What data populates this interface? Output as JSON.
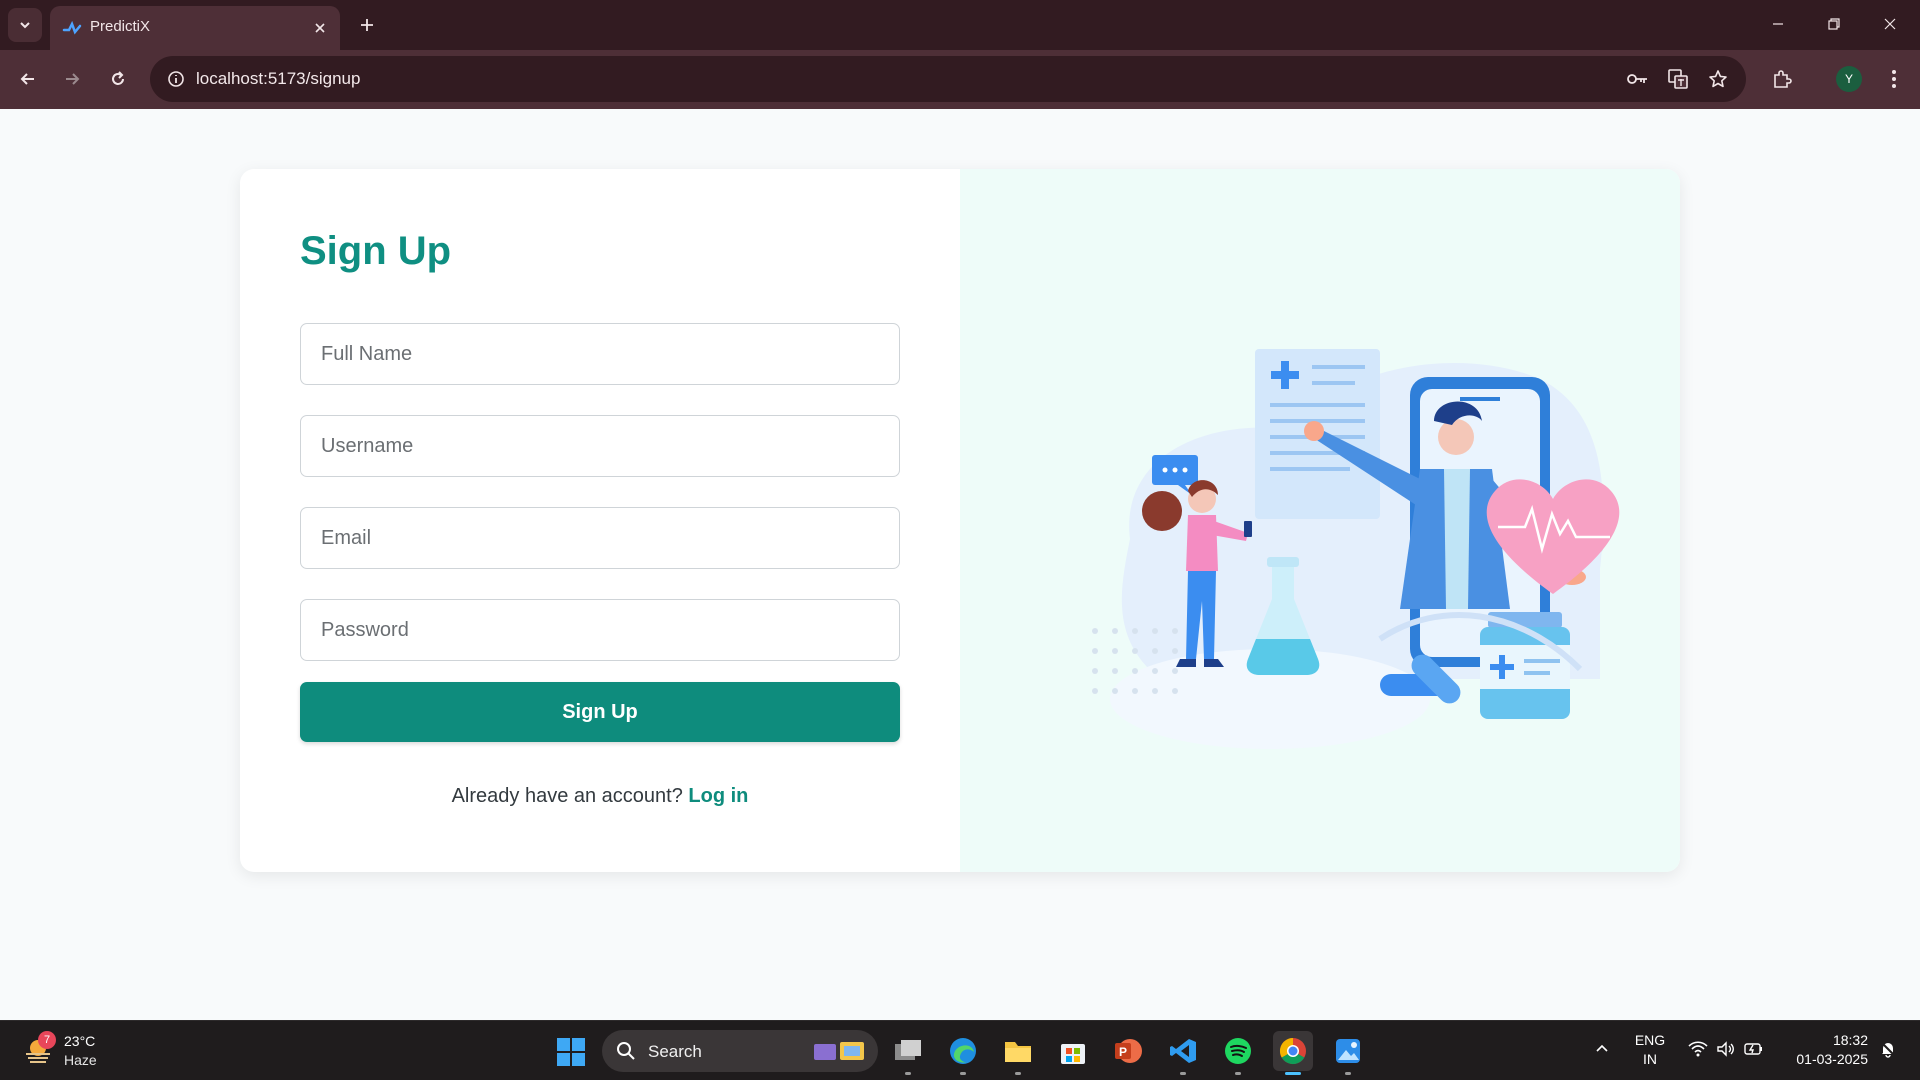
{
  "browser": {
    "tab_title": "PredictiX",
    "url": "localhost:5173/signup",
    "profile_initial": "Y",
    "theme_color": "#321b21"
  },
  "signup": {
    "heading": "Sign Up",
    "fields": {
      "full_name_placeholder": "Full Name",
      "username_placeholder": "Username",
      "email_placeholder": "Email",
      "password_placeholder": "Password"
    },
    "submit_label": "Sign Up",
    "login_prompt": "Already have an account?",
    "login_link": "Log in",
    "accent_color": "#0e8c7d"
  },
  "taskbar": {
    "weather_badge": "7",
    "temperature": "23°C",
    "condition": "Haze",
    "search_label": "Search",
    "language_line1": "ENG",
    "language_line2": "IN",
    "time": "18:32",
    "date": "01-03-2025",
    "apps": [
      "task-view",
      "edge",
      "file-explorer",
      "microsoft-store",
      "powerpoint",
      "vs-code",
      "spotify",
      "chrome",
      "photos"
    ]
  }
}
